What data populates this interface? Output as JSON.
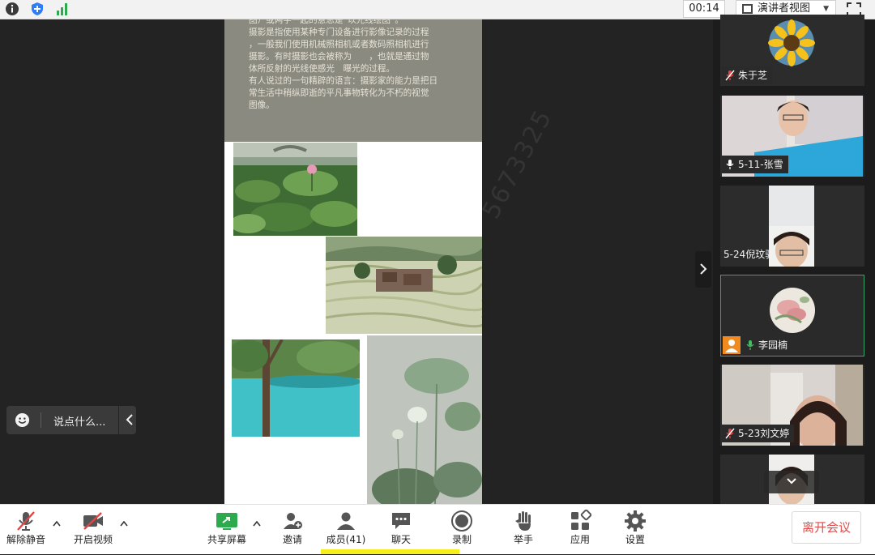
{
  "topbar": {
    "timer": "00:14",
    "view_mode": "演讲者视图"
  },
  "document": {
    "lines": [
      "图）或两字一起的意思是“以光线绘图”。",
      "摄影是指使用某种专门设备进行影像记录的过程",
      "，一般我们使用机械照相机或者数码照相机进行",
      "摄影。有时摄影也会被称为",
      "，也就是通过物",
      "体所反射的光线使感光",
      "曝光的过程。",
      "有人说过的一句精辟的语言：摄影家的能力是把日",
      "常生活中稍纵即逝的平凡事物转化为不朽的视觉",
      "图像。"
    ],
    "watermark": "5673325"
  },
  "chat_input": {
    "placeholder": "说点什么..."
  },
  "participants": [
    {
      "name": "朱于芝",
      "muted": true
    },
    {
      "name": "5-11-张雪",
      "muted": false
    },
    {
      "name": "5-24倪玟骁",
      "muted": false
    },
    {
      "name": "李园楠",
      "muted": false,
      "host": true
    },
    {
      "name": "5-23刘文婷",
      "muted": true
    },
    {
      "name": "",
      "muted": false
    }
  ],
  "toolbar": {
    "unmute": "解除静音",
    "start_video": "开启视频",
    "share_screen": "共享屏幕",
    "invite": "邀请",
    "members": "成员(41)",
    "chat": "聊天",
    "record": "录制",
    "raise_hand": "举手",
    "apps": "应用",
    "settings": "设置",
    "leave": "离开会议"
  },
  "colors": {
    "accent": "#39a468",
    "leave_red": "#e14b4b",
    "mute_red": "#e04646",
    "doc_text_bg": "#8b8a80"
  }
}
